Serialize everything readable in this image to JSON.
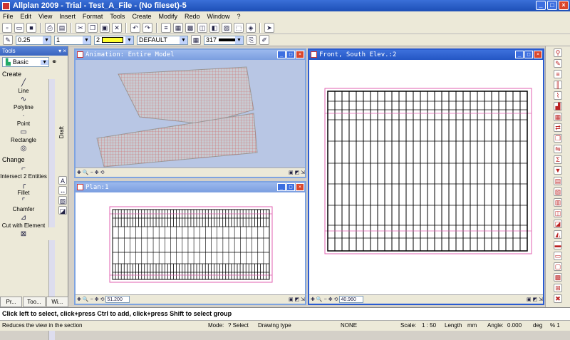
{
  "app": {
    "title": "Allplan 2009 - Trial - Test_A_File - (No fileset)-5"
  },
  "menu": [
    "File",
    "Edit",
    "View",
    "Insert",
    "Format",
    "Tools",
    "Create",
    "Modify",
    "Redo",
    "Window",
    "?"
  ],
  "props": {
    "pen": "0.25",
    "line": "1",
    "color": "2",
    "layer": "DEFAULT",
    "pattern": "317"
  },
  "palette": {
    "title": "Tools",
    "selector": "Basic",
    "draft_label": "Draft",
    "create_label": "Create",
    "create_tools": [
      "Line",
      "Polyline",
      "Point",
      "Rectangle"
    ],
    "change_label": "Change",
    "change_tools": [
      "Intersect 2 Entities",
      "Fillet",
      "Chamfer",
      "Cut with Element"
    ],
    "tabs": [
      "Pr...",
      "Too...",
      "Wi..."
    ]
  },
  "windows": {
    "animation": {
      "title": "Animation: Entire Model"
    },
    "front": {
      "title": "Front, South Elev.:2",
      "zoom": "40.960"
    },
    "plan": {
      "title": "Plan:1",
      "zoom": "51.200"
    }
  },
  "prompt": "Click left to select, click+press Ctrl to add, click+press Shift to select group",
  "status": {
    "hint": "Reduces the view in the section",
    "mode_label": "Mode:",
    "mode_value": "? Select",
    "drawing_type_label": "Drawing type",
    "none": "NONE",
    "scale_label": "Scale:",
    "scale_value": "1 : 50",
    "length_label": "Length",
    "length_value": "mm",
    "angle_label": "Angle:",
    "angle_value": "0.000",
    "deg": "deg",
    "percent": "% 1"
  },
  "colors": {
    "model_lines": "#d44848",
    "frame": "#e060b0",
    "grid": "#000000"
  }
}
